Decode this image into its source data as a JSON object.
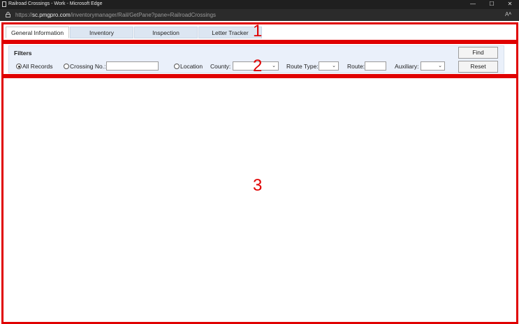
{
  "window": {
    "title": "Railroad Crossings - Work - Microsoft Edge",
    "minimize_glyph": "—",
    "maximize_glyph": "☐",
    "close_glyph": "✕"
  },
  "address": {
    "scheme": "https://",
    "host": "sc.pmgpro.com",
    "path": "/inventorymanager/Rail/GetPane?pane=RailroadCrossings",
    "read_aloud": "Aᴬ"
  },
  "tabs": [
    {
      "label": "General Information",
      "active": true
    },
    {
      "label": "Inventory",
      "active": false
    },
    {
      "label": "Inspection",
      "active": false
    },
    {
      "label": "Letter Tracker",
      "active": false
    }
  ],
  "filters": {
    "title": "Filters",
    "all_records": "All Records",
    "crossing_no": "Crossing No.:",
    "location": "Location",
    "county": "County:",
    "route_type": "Route Type:",
    "route": "Route:",
    "auxiliary": "Auxiliary:",
    "find": "Find",
    "reset": "Reset",
    "crossing_no_value": "",
    "route_value": ""
  },
  "annotations": [
    "1",
    "2",
    "3"
  ],
  "colors": {
    "highlight": "#e00000",
    "tab_inactive": "#dce6f2",
    "filter_panel": "#eaf0fa"
  }
}
